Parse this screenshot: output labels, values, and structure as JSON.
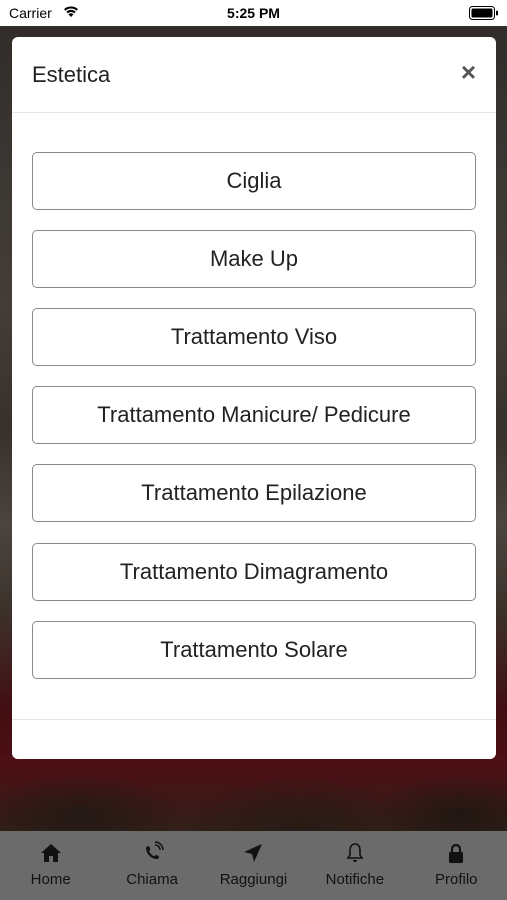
{
  "status_bar": {
    "carrier": "Carrier",
    "time": "5:25 PM"
  },
  "modal": {
    "title": "Estetica",
    "close_symbol": "×",
    "options": [
      {
        "label": "Ciglia"
      },
      {
        "label": "Make Up"
      },
      {
        "label": "Trattamento Viso"
      },
      {
        "label": "Trattamento Manicure/ Pedicure"
      },
      {
        "label": "Trattamento Epilazione"
      },
      {
        "label": "Trattamento Dimagramento"
      },
      {
        "label": "Trattamento Solare"
      }
    ]
  },
  "tab_bar": {
    "items": [
      {
        "label": "Home",
        "icon": "home-icon"
      },
      {
        "label": "Chiama",
        "icon": "phone-icon"
      },
      {
        "label": "Raggiungi",
        "icon": "navigation-arrow-icon"
      },
      {
        "label": "Notifiche",
        "icon": "bell-icon"
      },
      {
        "label": "Profilo",
        "icon": "lock-icon"
      }
    ]
  },
  "colors": {
    "tab_bar_bg": "#6b6b6b",
    "modal_bg": "#ffffff",
    "button_border": "#8a8a8a"
  }
}
